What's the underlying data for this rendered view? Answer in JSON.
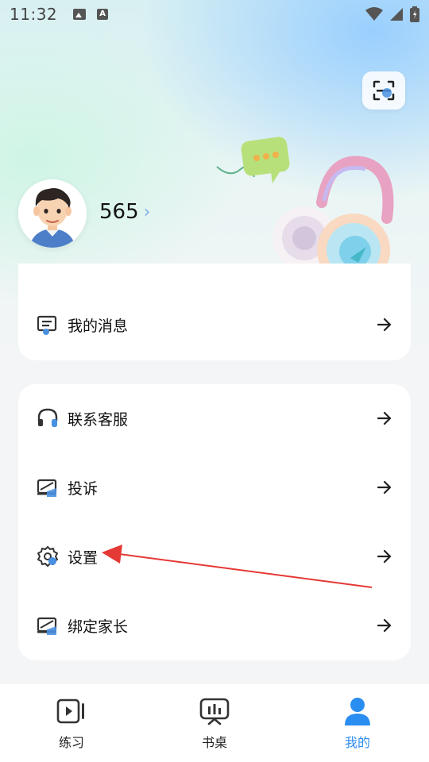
{
  "status_bar": {
    "time": "11:32",
    "image_icon": "image-icon",
    "a_icon": "a-icon"
  },
  "header": {
    "scan_icon": "scan-icon"
  },
  "profile": {
    "username": "565",
    "avatar_icon": "avatar-boy"
  },
  "card_top": {
    "items": [
      {
        "label": "我的消息",
        "icon": "message-icon"
      }
    ]
  },
  "card_menu": {
    "items": [
      {
        "label": "联系客服",
        "icon": "headset-icon"
      },
      {
        "label": "投诉",
        "icon": "complaint-icon"
      },
      {
        "label": "设置",
        "icon": "settings-icon"
      },
      {
        "label": "绑定家长",
        "icon": "bind-parent-icon"
      }
    ]
  },
  "tabs": [
    {
      "label": "练习",
      "icon": "practice-icon",
      "active": false
    },
    {
      "label": "书桌",
      "icon": "desk-icon",
      "active": false
    },
    {
      "label": "我的",
      "icon": "profile-icon",
      "active": true
    }
  ],
  "colors": {
    "accent": "#2a8df0",
    "annotation": "#e53935"
  }
}
